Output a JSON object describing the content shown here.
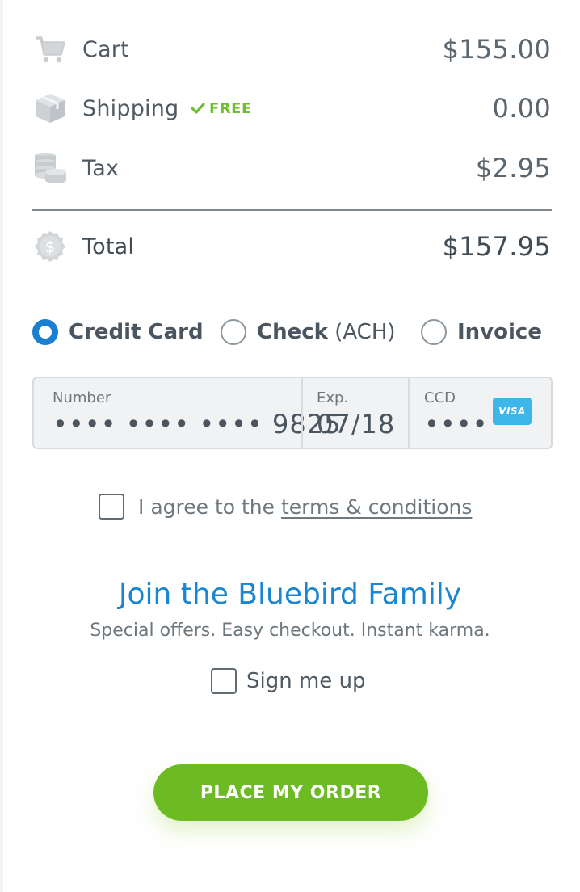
{
  "summary": {
    "cart": {
      "label": "Cart",
      "amount": "$155.00",
      "icon": "cart-icon"
    },
    "shipping": {
      "label": "Shipping",
      "badge": "FREE",
      "amount": "0.00",
      "icon": "box-icon"
    },
    "tax": {
      "label": "Tax",
      "amount": "$2.95",
      "icon": "coins-icon"
    },
    "total": {
      "label": "Total",
      "amount": "$157.95",
      "icon": "dollar-seal-icon"
    }
  },
  "payment": {
    "selected": "Credit Card",
    "options": [
      {
        "bold": "Credit Card",
        "light": ""
      },
      {
        "bold": "Check",
        "light": " (ACH)"
      },
      {
        "bold": "Invoice",
        "light": ""
      }
    ]
  },
  "card": {
    "number_label": "Number",
    "number_value": "•••• •••• •••• 9825",
    "exp_label": "Exp.",
    "exp_value": "07/18",
    "ccd_label": "CCD",
    "ccd_value": "••••",
    "brand": "VISA"
  },
  "terms": {
    "prefix": "I agree to the ",
    "link": "terms & conditions"
  },
  "join": {
    "title": "Join the Bluebird Family",
    "subtitle": "Special offers. Easy checkout. Instant karma.",
    "signup_label": "Sign me up"
  },
  "order_button": "PLACE MY ORDER",
  "colors": {
    "accent_blue": "#1a7fd1",
    "title_blue": "#1a86cf",
    "green": "#6cbb22",
    "free_green": "#6cbf2a",
    "visa_blue": "#3fb6e8"
  }
}
